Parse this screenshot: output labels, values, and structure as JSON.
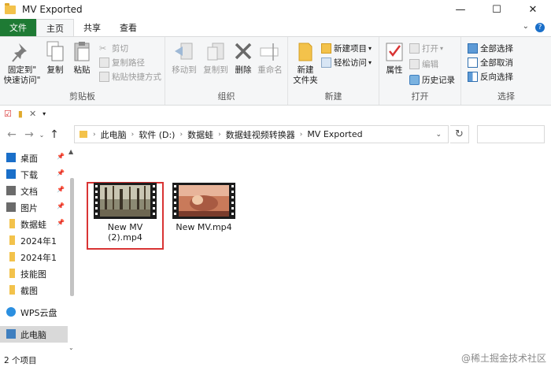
{
  "window": {
    "title": "MV Exported",
    "min": "—",
    "max": "☐",
    "close": "✕"
  },
  "tabs": [
    "文件",
    "主页",
    "共享",
    "查看"
  ],
  "ribbon": {
    "clipboard": {
      "label": "剪贴板",
      "pin": [
        "固定到\"",
        "快速访问\""
      ],
      "copy": "复制",
      "paste": "粘贴",
      "cut": "剪切",
      "copy_path": "复制路径",
      "paste_shortcut": "粘贴快捷方式"
    },
    "organize": {
      "label": "组织",
      "move_to": "移动到",
      "copy_to": "复制到",
      "delete": "删除",
      "rename": "重命名"
    },
    "new": {
      "label": "新建",
      "new_item": "新建项目",
      "easy_access": "轻松访问",
      "new_folder": [
        "新建",
        "文件夹"
      ]
    },
    "open": {
      "label": "打开",
      "properties": "属性",
      "open": "打开",
      "edit": "编辑",
      "history": "历史记录"
    },
    "select": {
      "label": "选择",
      "select_all": "全部选择",
      "select_none": "全部取消",
      "invert": "反向选择"
    }
  },
  "breadcrumb": [
    "此电脑",
    "软件 (D:)",
    "数据蛙",
    "数据蛙视频转换器",
    "MV Exported"
  ],
  "nav": [
    {
      "label": "桌面",
      "pinned": true,
      "icon": "desktop-icon",
      "color": "#1a6fc9"
    },
    {
      "label": "下载",
      "pinned": true,
      "icon": "download-icon",
      "color": "#1a6fc9"
    },
    {
      "label": "文档",
      "pinned": true,
      "icon": "document-icon",
      "color": "#6b6b6b"
    },
    {
      "label": "图片",
      "pinned": true,
      "icon": "picture-icon",
      "color": "#6b6b6b"
    },
    {
      "label": "数据蛙",
      "pinned": true,
      "icon": "folder-icon",
      "color": "#f3c24b"
    },
    {
      "label": "2024年1",
      "pinned": false,
      "icon": "folder-icon",
      "color": "#f3c24b"
    },
    {
      "label": "2024年1",
      "pinned": false,
      "icon": "folder-icon",
      "color": "#f3c24b"
    },
    {
      "label": "技能图",
      "pinned": false,
      "icon": "folder-icon",
      "color": "#f3c24b"
    },
    {
      "label": "截图",
      "pinned": false,
      "icon": "folder-icon",
      "color": "#f3c24b"
    },
    {
      "label": "WPS云盘",
      "pinned": false,
      "icon": "cloud-icon",
      "color": "#2b8fe0"
    },
    {
      "label": "此电脑",
      "pinned": false,
      "icon": "computer-icon",
      "color": "#3f7fbf"
    }
  ],
  "files": [
    {
      "name": "New MV (2).mp4",
      "lines": [
        "New MV",
        "(2).mp4"
      ],
      "selected": true
    },
    {
      "name": "New MV.mp4",
      "lines": [
        "New MV.mp4"
      ],
      "selected": false
    }
  ],
  "status": {
    "count": "2 个项目"
  },
  "watermark": "@稀土掘金技术社区"
}
